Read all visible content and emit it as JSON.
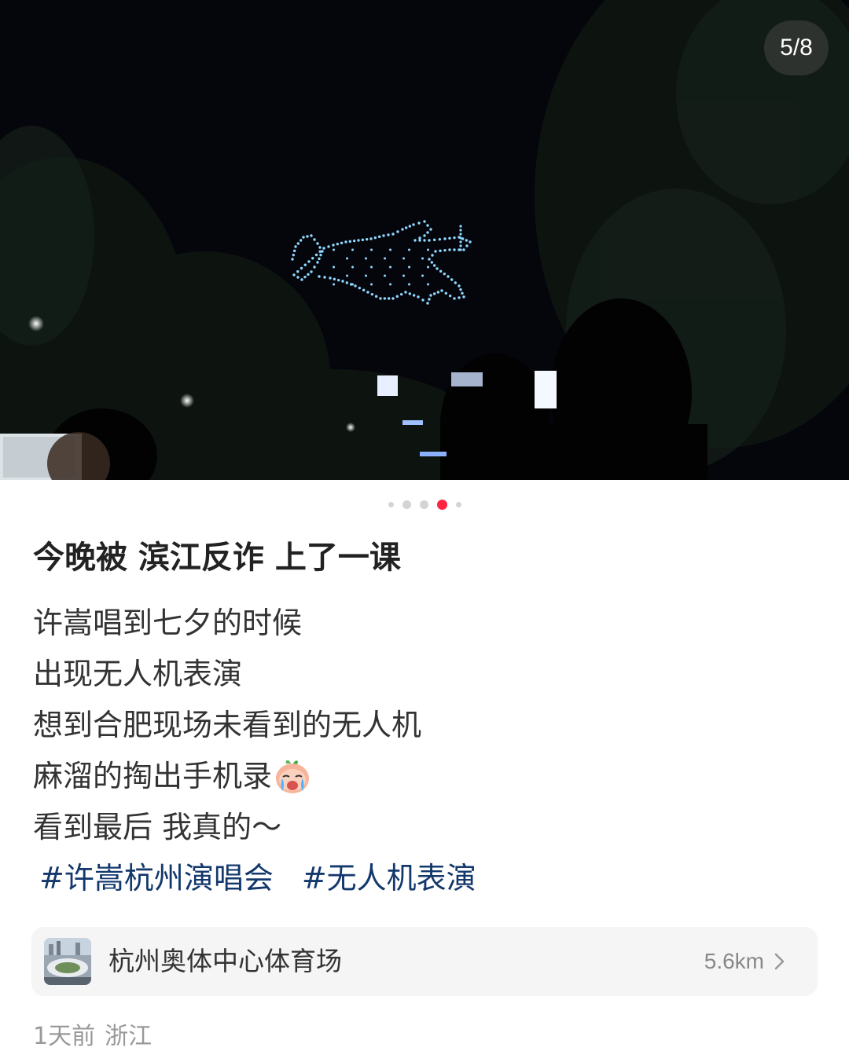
{
  "photo": {
    "description_icon": "drone-show-photo",
    "page_counter": "5/8"
  },
  "carousel": {
    "count": 5,
    "active_index": 3
  },
  "post": {
    "title": "今晚被 滨江反诈 上了一课",
    "lines": [
      "许嵩唱到七夕的时候",
      "出现无人机表演",
      "想到合肥现场未看到的无人机",
      "麻溜的掏出手机录",
      "看到最后 我真的～"
    ],
    "emoji_icon": "crying-face-emoji-icon",
    "tags": [
      "#许嵩杭州演唱会",
      "#无人机表演"
    ]
  },
  "location": {
    "name": "杭州奥体中心体育场",
    "distance": "5.6km",
    "thumb_icon": "stadium-thumbnail-icon"
  },
  "meta": {
    "time": "1天前",
    "region": "浙江"
  },
  "colors": {
    "accent": "#ff2442",
    "tag": "#13386c",
    "drone_light": "#8fd8ff"
  }
}
